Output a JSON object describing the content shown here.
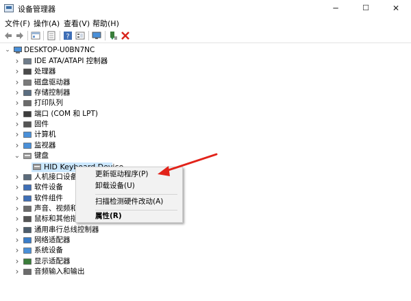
{
  "window": {
    "title": "设备管理器",
    "minimize": "─",
    "maximize": "☐",
    "close": "✕"
  },
  "menu": [
    "文件(F)",
    "操作(A)",
    "查看(V)",
    "帮助(H)"
  ],
  "toolbar": [
    "back-icon",
    "forward-icon",
    "properties-icon",
    "print-icon",
    "help-icon",
    "device-view-icon",
    "monitor-icon",
    "install-icon",
    "uninstall-icon"
  ],
  "tree": {
    "root": "DESKTOP-U0BN7NC",
    "items": [
      {
        "label": "IDE ATA/ATAPI 控制器",
        "icon": "ide-controller-icon",
        "state": "collapsed"
      },
      {
        "label": "处理器",
        "icon": "processor-icon",
        "state": "collapsed"
      },
      {
        "label": "磁盘驱动器",
        "icon": "disk-drive-icon",
        "state": "collapsed"
      },
      {
        "label": "存储控制器",
        "icon": "storage-controller-icon",
        "state": "collapsed"
      },
      {
        "label": "打印队列",
        "icon": "printer-icon",
        "state": "collapsed"
      },
      {
        "label": "端口 (COM 和 LPT)",
        "icon": "port-icon",
        "state": "collapsed"
      },
      {
        "label": "固件",
        "icon": "firmware-icon",
        "state": "collapsed"
      },
      {
        "label": "计算机",
        "icon": "computer-icon",
        "state": "collapsed"
      },
      {
        "label": "监视器",
        "icon": "monitor-icon",
        "state": "collapsed"
      },
      {
        "label": "键盘",
        "icon": "keyboard-icon",
        "state": "expanded"
      },
      {
        "label": "HID Keyboard Device",
        "icon": "keyboard-device-icon",
        "state": "child"
      },
      {
        "label": "人机接口设备",
        "icon": "hid-icon",
        "state": "collapsed"
      },
      {
        "label": "软件设备",
        "icon": "software-device-icon",
        "state": "collapsed"
      },
      {
        "label": "软件组件",
        "icon": "software-component-icon",
        "state": "collapsed"
      },
      {
        "label": "声音、视频和游",
        "icon": "sound-icon",
        "state": "collapsed"
      },
      {
        "label": "鼠标和其他指针",
        "icon": "mouse-icon",
        "state": "collapsed"
      },
      {
        "label": "通用串行总线控制器",
        "icon": "usb-icon",
        "state": "collapsed"
      },
      {
        "label": "网络适配器",
        "icon": "network-icon",
        "state": "collapsed"
      },
      {
        "label": "系统设备",
        "icon": "system-device-icon",
        "state": "collapsed"
      },
      {
        "label": "显示适配器",
        "icon": "display-adapter-icon",
        "state": "collapsed"
      },
      {
        "label": "音频输入和输出",
        "icon": "audio-io-icon",
        "state": "collapsed"
      }
    ]
  },
  "context_menu": {
    "update_driver": "更新驱动程序(P)",
    "uninstall": "卸载设备(U)",
    "scan": "扫描检测硬件改动(A)",
    "properties": "属性(R)"
  },
  "colors": {
    "selection": "#cce8ff",
    "arrow": "#e2231a",
    "menu_bg": "#f2f2f2"
  }
}
